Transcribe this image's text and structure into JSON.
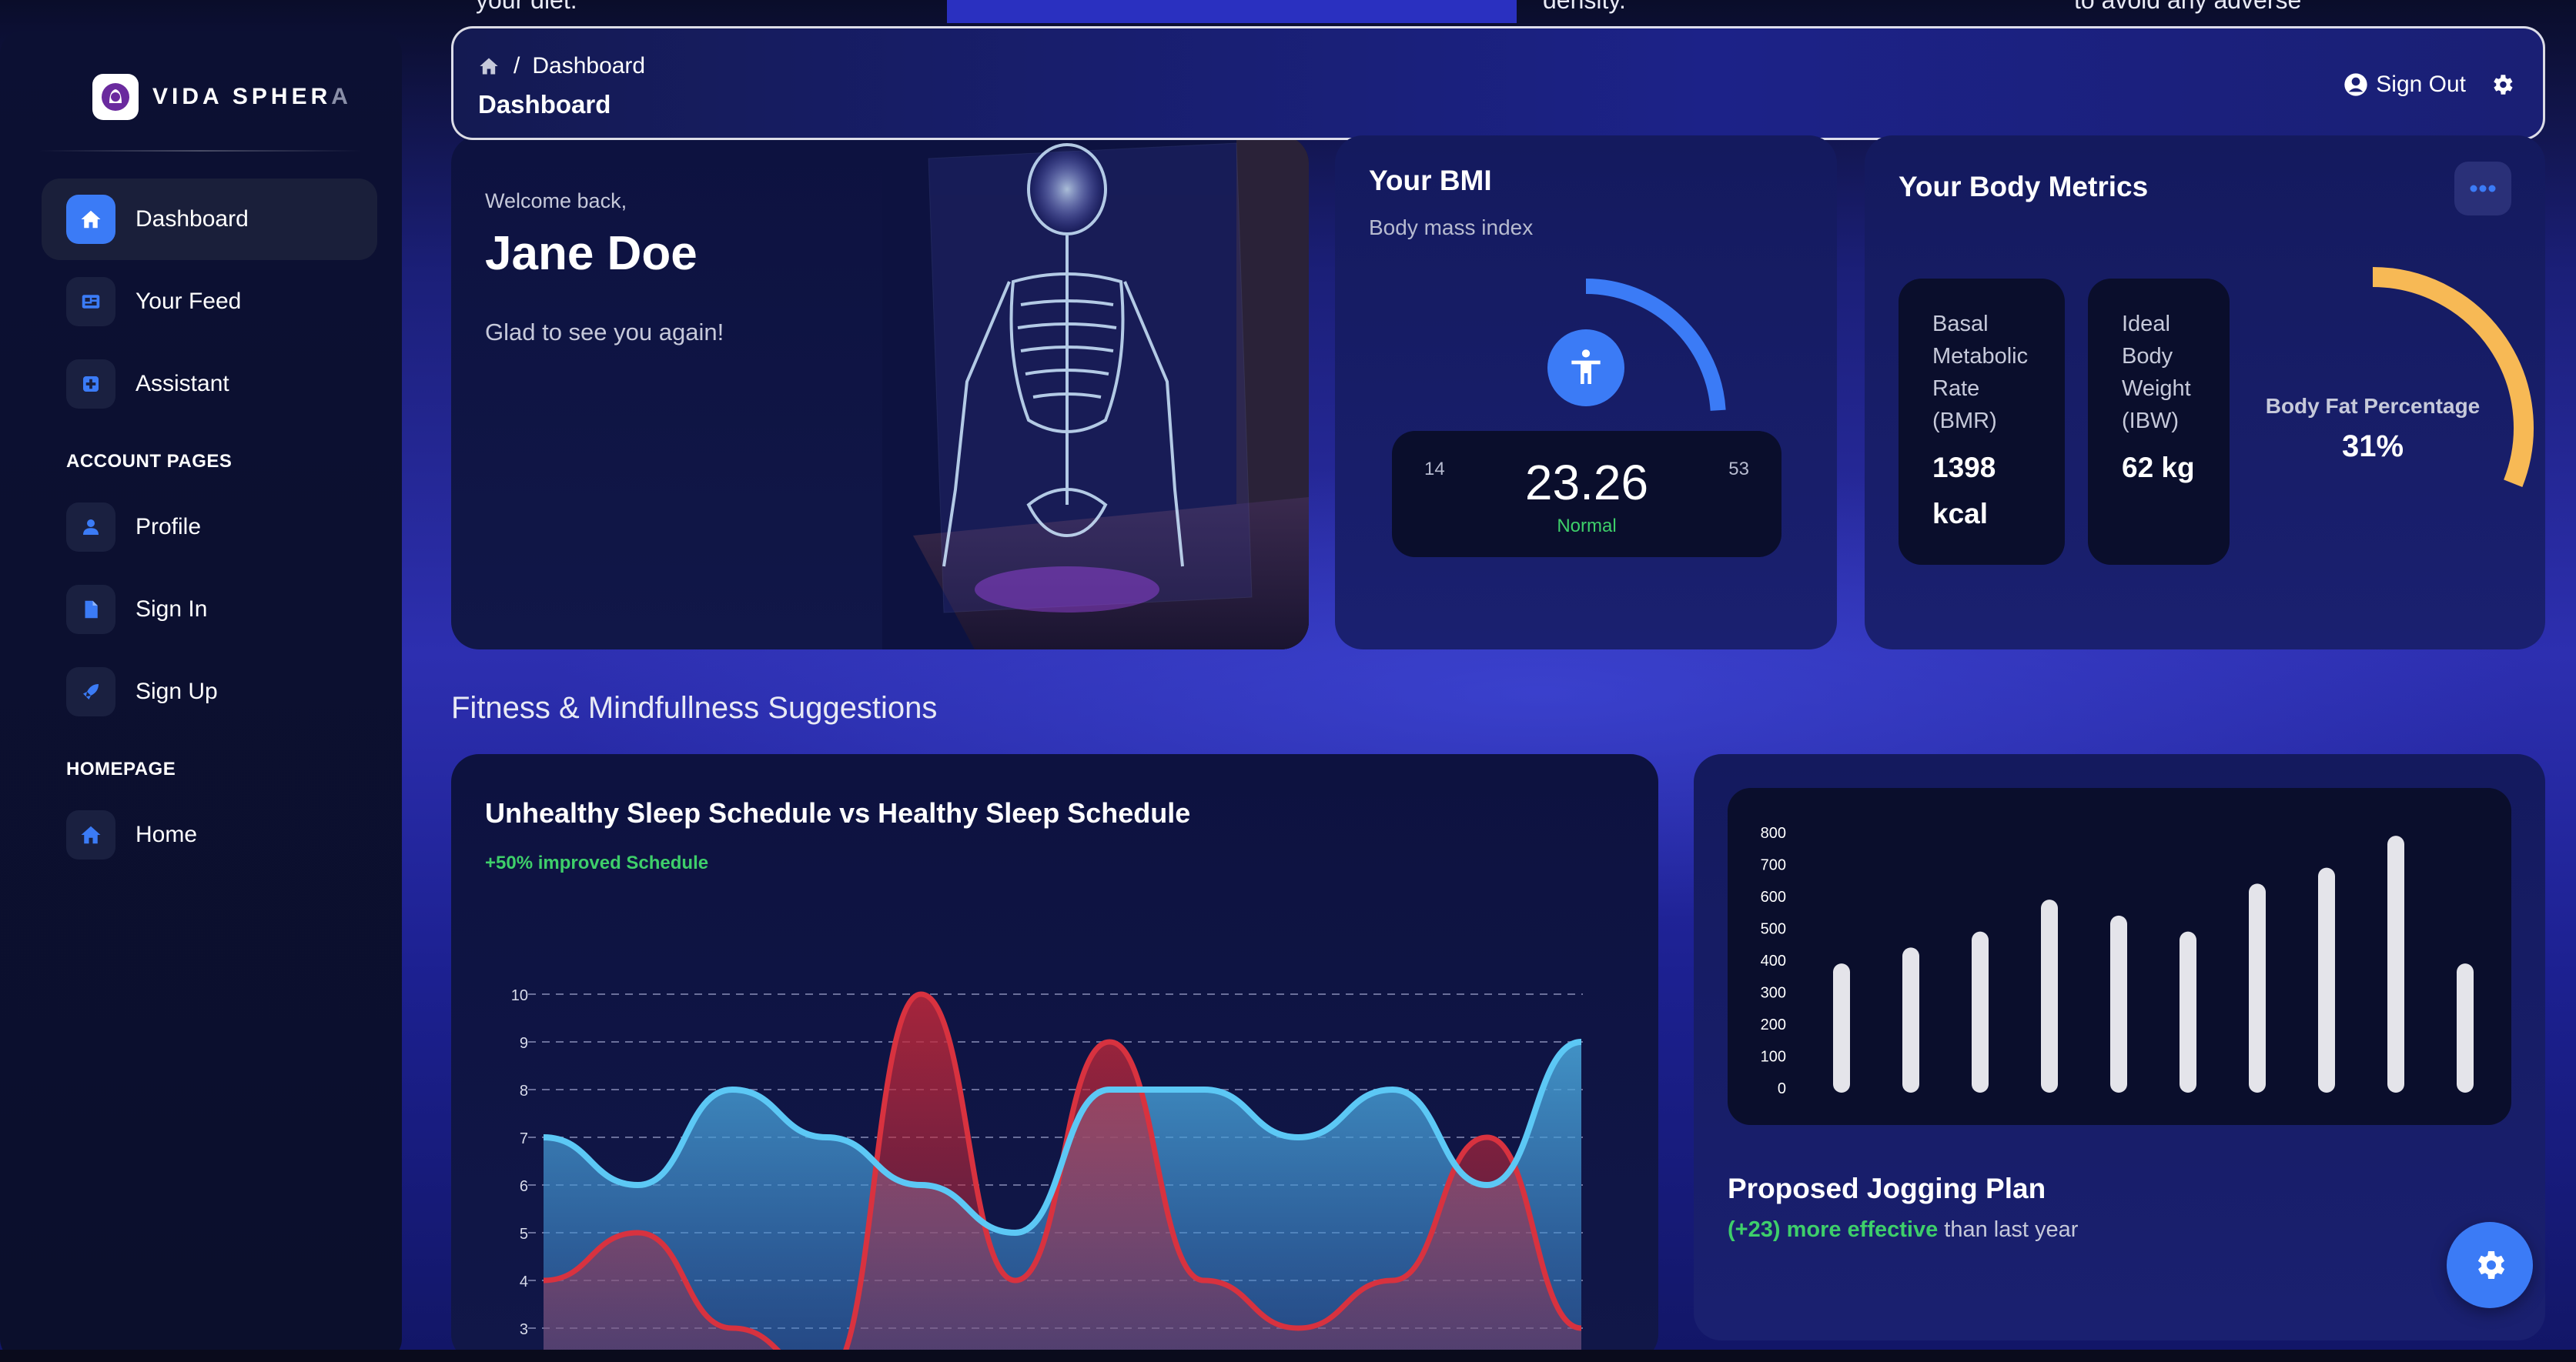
{
  "top_strip": {
    "text1": "your diet.",
    "text2": "density.",
    "text3": "to avoid any adverse"
  },
  "brand": {
    "name_main": "VIDA SPHER",
    "name_fade": "A"
  },
  "sidebar": {
    "items": [
      {
        "label": "Dashboard"
      },
      {
        "label": "Your Feed"
      },
      {
        "label": "Assistant"
      }
    ],
    "section_account": "ACCOUNT PAGES",
    "account_items": [
      {
        "label": "Profile"
      },
      {
        "label": "Sign In"
      },
      {
        "label": "Sign Up"
      }
    ],
    "section_homepage": "HOMEPAGE",
    "homepage_items": [
      {
        "label": "Home"
      }
    ]
  },
  "header": {
    "breadcrumb_sep": "/",
    "breadcrumb_current": "Dashboard",
    "title": "Dashboard",
    "signout_label": "Sign Out"
  },
  "welcome": {
    "greeting": "Welcome back,",
    "name": "Jane Doe",
    "message": "Glad to see you again!"
  },
  "bmi": {
    "title": "Your BMI",
    "subtitle": "Body mass index",
    "min": "14",
    "max": "53",
    "value": "23.26",
    "status": "Normal",
    "gauge_fraction": 0.24
  },
  "metrics": {
    "title": "Your Body Metrics",
    "bmr_label_lines": [
      "Basal",
      "Metabolic",
      "Rate",
      "(BMR)"
    ],
    "bmr_value_lines": [
      "1398",
      "kcal"
    ],
    "ibw_label_lines": [
      "Ideal",
      "Body",
      "Weight",
      "(IBW)"
    ],
    "ibw_value": "62 kg",
    "bodyfat_label": "Body Fat Percentage",
    "bodyfat_value": "31%",
    "bodyfat_fraction": 0.31
  },
  "section_title": "Fitness & Mindfullness Suggestions",
  "sleep_chart": {
    "title": "Unhealthy Sleep Schedule vs Healthy Sleep Schedule",
    "subtitle": "+50% improved Schedule"
  },
  "jogging": {
    "title": "Proposed Jogging Plan",
    "sub_highlight": "(+23) more effective",
    "sub_rest": " than last year"
  },
  "colors": {
    "accent": "#3b7bf6",
    "green": "#3ecf6a",
    "gauge_orange": "#f7b955",
    "sleep_blue": "#5cc8f5",
    "sleep_red": "#d8323f"
  },
  "chart_data": [
    {
      "type": "area",
      "x": [
        0,
        1,
        2,
        3,
        4,
        5,
        6,
        7,
        8,
        9,
        10,
        11
      ],
      "series": [
        {
          "values": [
            7,
            6,
            8,
            7,
            6,
            5,
            8,
            8,
            7,
            8,
            6,
            9
          ]
        },
        {
          "values": [
            4,
            5,
            3,
            2,
            10,
            4,
            9,
            4,
            3,
            4,
            7,
            3
          ]
        }
      ],
      "yticks": [
        3,
        4,
        5,
        6,
        7,
        8,
        9,
        10
      ],
      "ylim": [
        3,
        10
      ],
      "grid": true
    },
    {
      "type": "bar",
      "categories": [
        "",
        "",
        "",
        "",
        "",
        "",
        "",
        "",
        "",
        ""
      ],
      "values": [
        390,
        440,
        490,
        590,
        540,
        490,
        640,
        690,
        790,
        390
      ],
      "yticks": [
        0,
        100,
        200,
        300,
        400,
        500,
        600,
        700,
        800
      ],
      "ylim": [
        0,
        800
      ],
      "grid": false
    }
  ]
}
